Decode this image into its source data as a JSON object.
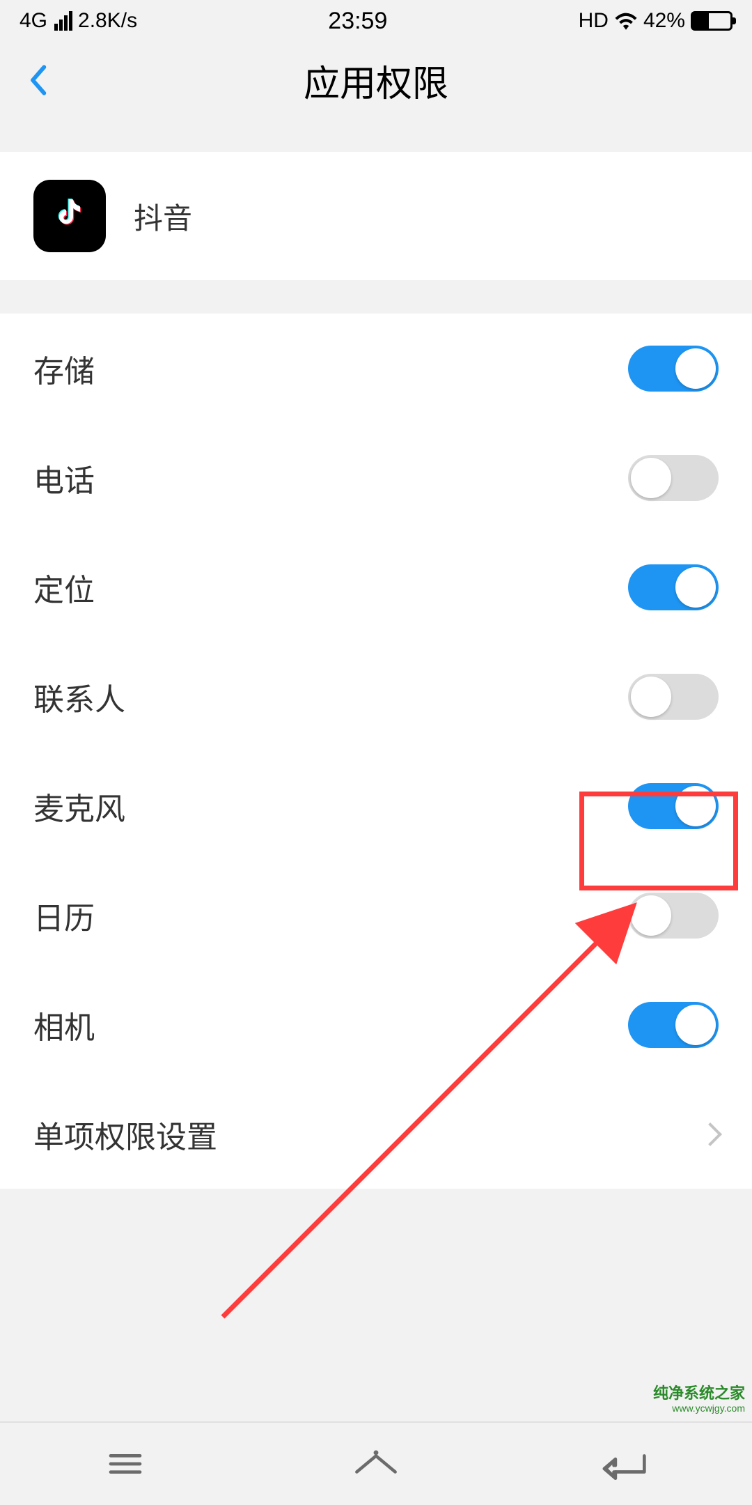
{
  "status": {
    "network": "4G",
    "speed": "2.8K/s",
    "time": "23:59",
    "hd": "HD",
    "battery_pct": "42%"
  },
  "header": {
    "title": "应用权限"
  },
  "app": {
    "name": "抖音"
  },
  "permissions": [
    {
      "label": "存储",
      "enabled": true,
      "key": "storage"
    },
    {
      "label": "电话",
      "enabled": false,
      "key": "phone"
    },
    {
      "label": "定位",
      "enabled": true,
      "key": "location"
    },
    {
      "label": "联系人",
      "enabled": false,
      "key": "contacts"
    },
    {
      "label": "麦克风",
      "enabled": true,
      "key": "microphone"
    },
    {
      "label": "日历",
      "enabled": false,
      "key": "calendar"
    },
    {
      "label": "相机",
      "enabled": true,
      "key": "camera"
    }
  ],
  "advanced": {
    "label": "单项权限设置"
  },
  "watermark": {
    "line1": "纯净系统之家",
    "line2": "www.ycwjgy.com"
  }
}
